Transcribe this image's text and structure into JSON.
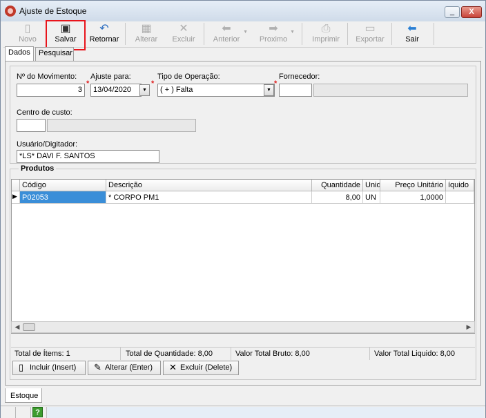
{
  "window": {
    "title": "Ajuste de Estoque",
    "min_label": "_",
    "close_label": "X"
  },
  "toolbar": {
    "novo": "Novo",
    "salvar": "Salvar",
    "retornar": "Retornar",
    "alterar": "Alterar",
    "excluir": "Excluir",
    "anterior": "Anterior",
    "proximo": "Proximo",
    "imprimir": "Imprimir",
    "exportar": "Exportar",
    "sair": "Sair"
  },
  "tabs_top": {
    "dados": "Dados",
    "pesquisar": "Pesquisar"
  },
  "form": {
    "movimento_label": "Nº do Movimento:",
    "movimento_value": "3",
    "ajuste_label": "Ajuste para:",
    "ajuste_value": "13/04/2020",
    "operacao_label": "Tipo de Operação:",
    "operacao_value": "( + ) Falta",
    "fornecedor_label": "Fornecedor:",
    "fornecedor_code": "",
    "fornecedor_name": "",
    "centro_label": "Centro de custo:",
    "centro_code": "",
    "centro_name": "",
    "usuario_label": "Usuário/Digitador:",
    "usuario_value": "*LS* DAVI F. SANTOS"
  },
  "produtos": {
    "title": "Produtos",
    "columns": {
      "codigo": "Código",
      "descricao": "Descrição",
      "quantidade": "Quantidade",
      "unidade": "Unid",
      "preco": "Preço Unitário",
      "liquido": "íquido"
    },
    "row": {
      "codigo": "P02053",
      "descricao": "* CORPO PM1",
      "quantidade": "8,00",
      "unidade": "UN",
      "preco": "1,0000",
      "liquido": ""
    }
  },
  "totals": {
    "itens": "Total de Ítems: 1",
    "quantidade": "Total de Quantidade: 8,00",
    "bruto": "Valor Total Bruto: 8,00",
    "liquido": "Valor Total Liquido: 8,00"
  },
  "actions": {
    "incluir": "Incluir (Insert)",
    "alterar": "Alterar (Enter)",
    "excluir": "Excluir (Delete)"
  },
  "tabs_bottom": {
    "estoque": "Estoque"
  },
  "status": {
    "help": "?"
  }
}
